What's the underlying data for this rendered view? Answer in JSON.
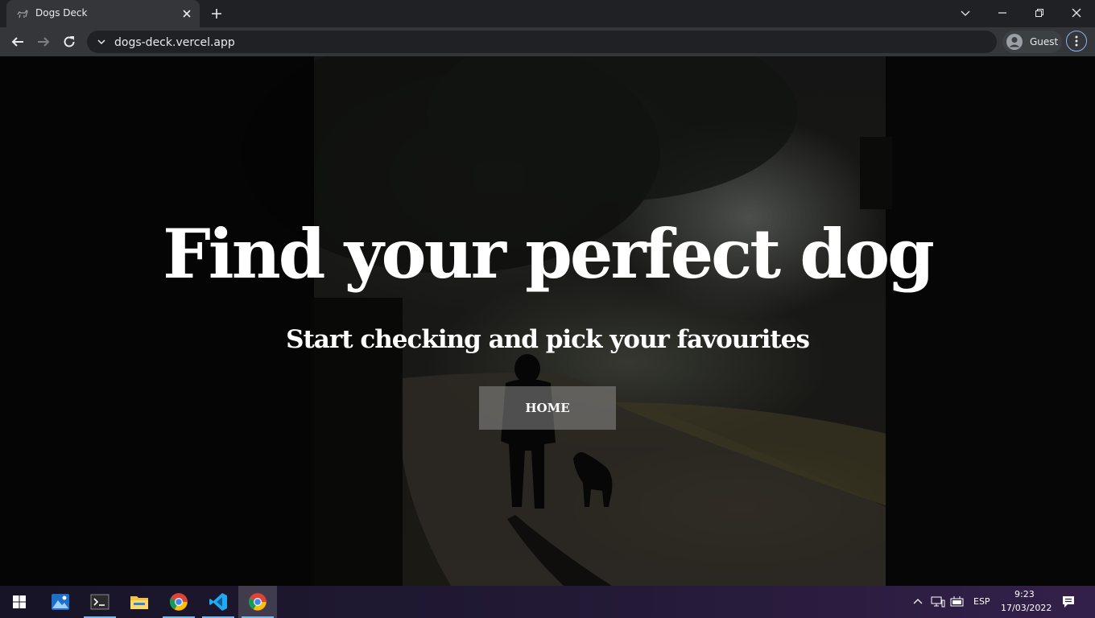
{
  "browser": {
    "tab": {
      "title": "Dogs Deck"
    },
    "url": "dogs-deck.vercel.app",
    "profile": {
      "label": "Guest"
    }
  },
  "hero": {
    "title": "Find your perfect dog",
    "subtitle": "Start checking and pick your favourites",
    "button_label": "HOME"
  },
  "taskbar": {
    "apps": [
      "photos-icon",
      "terminal-icon",
      "file-explorer-icon",
      "chrome-icon",
      "vscode-icon",
      "chrome-icon"
    ],
    "language": "ESP",
    "time": "9:23",
    "date": "17/03/2022"
  },
  "colors": {
    "tabstrip": "#202124",
    "toolbar": "#35363a",
    "accent": "#8ab4f8",
    "text": "#ffffff"
  }
}
